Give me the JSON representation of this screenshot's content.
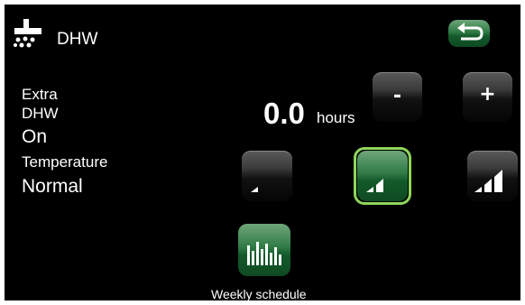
{
  "header": {
    "title": "DHW",
    "icon": "shower-icon",
    "back_icon": "back-arrow-icon"
  },
  "extra_dhw": {
    "label_line1": "Extra",
    "label_line2": "DHW",
    "state": "On",
    "hours_value": "0.0",
    "hours_unit": "hours",
    "minus": "-",
    "plus": "+"
  },
  "temperature": {
    "label": "Temperature",
    "value": "Normal",
    "levels": [
      "low",
      "normal",
      "high"
    ],
    "selected_level": "normal"
  },
  "schedule": {
    "label": "Weekly schedule",
    "icon": "bar-chart-icon"
  },
  "colors": {
    "background": "#000000",
    "text": "#ffffff",
    "green": "#2f7a45",
    "selection": "#8fd65a"
  }
}
